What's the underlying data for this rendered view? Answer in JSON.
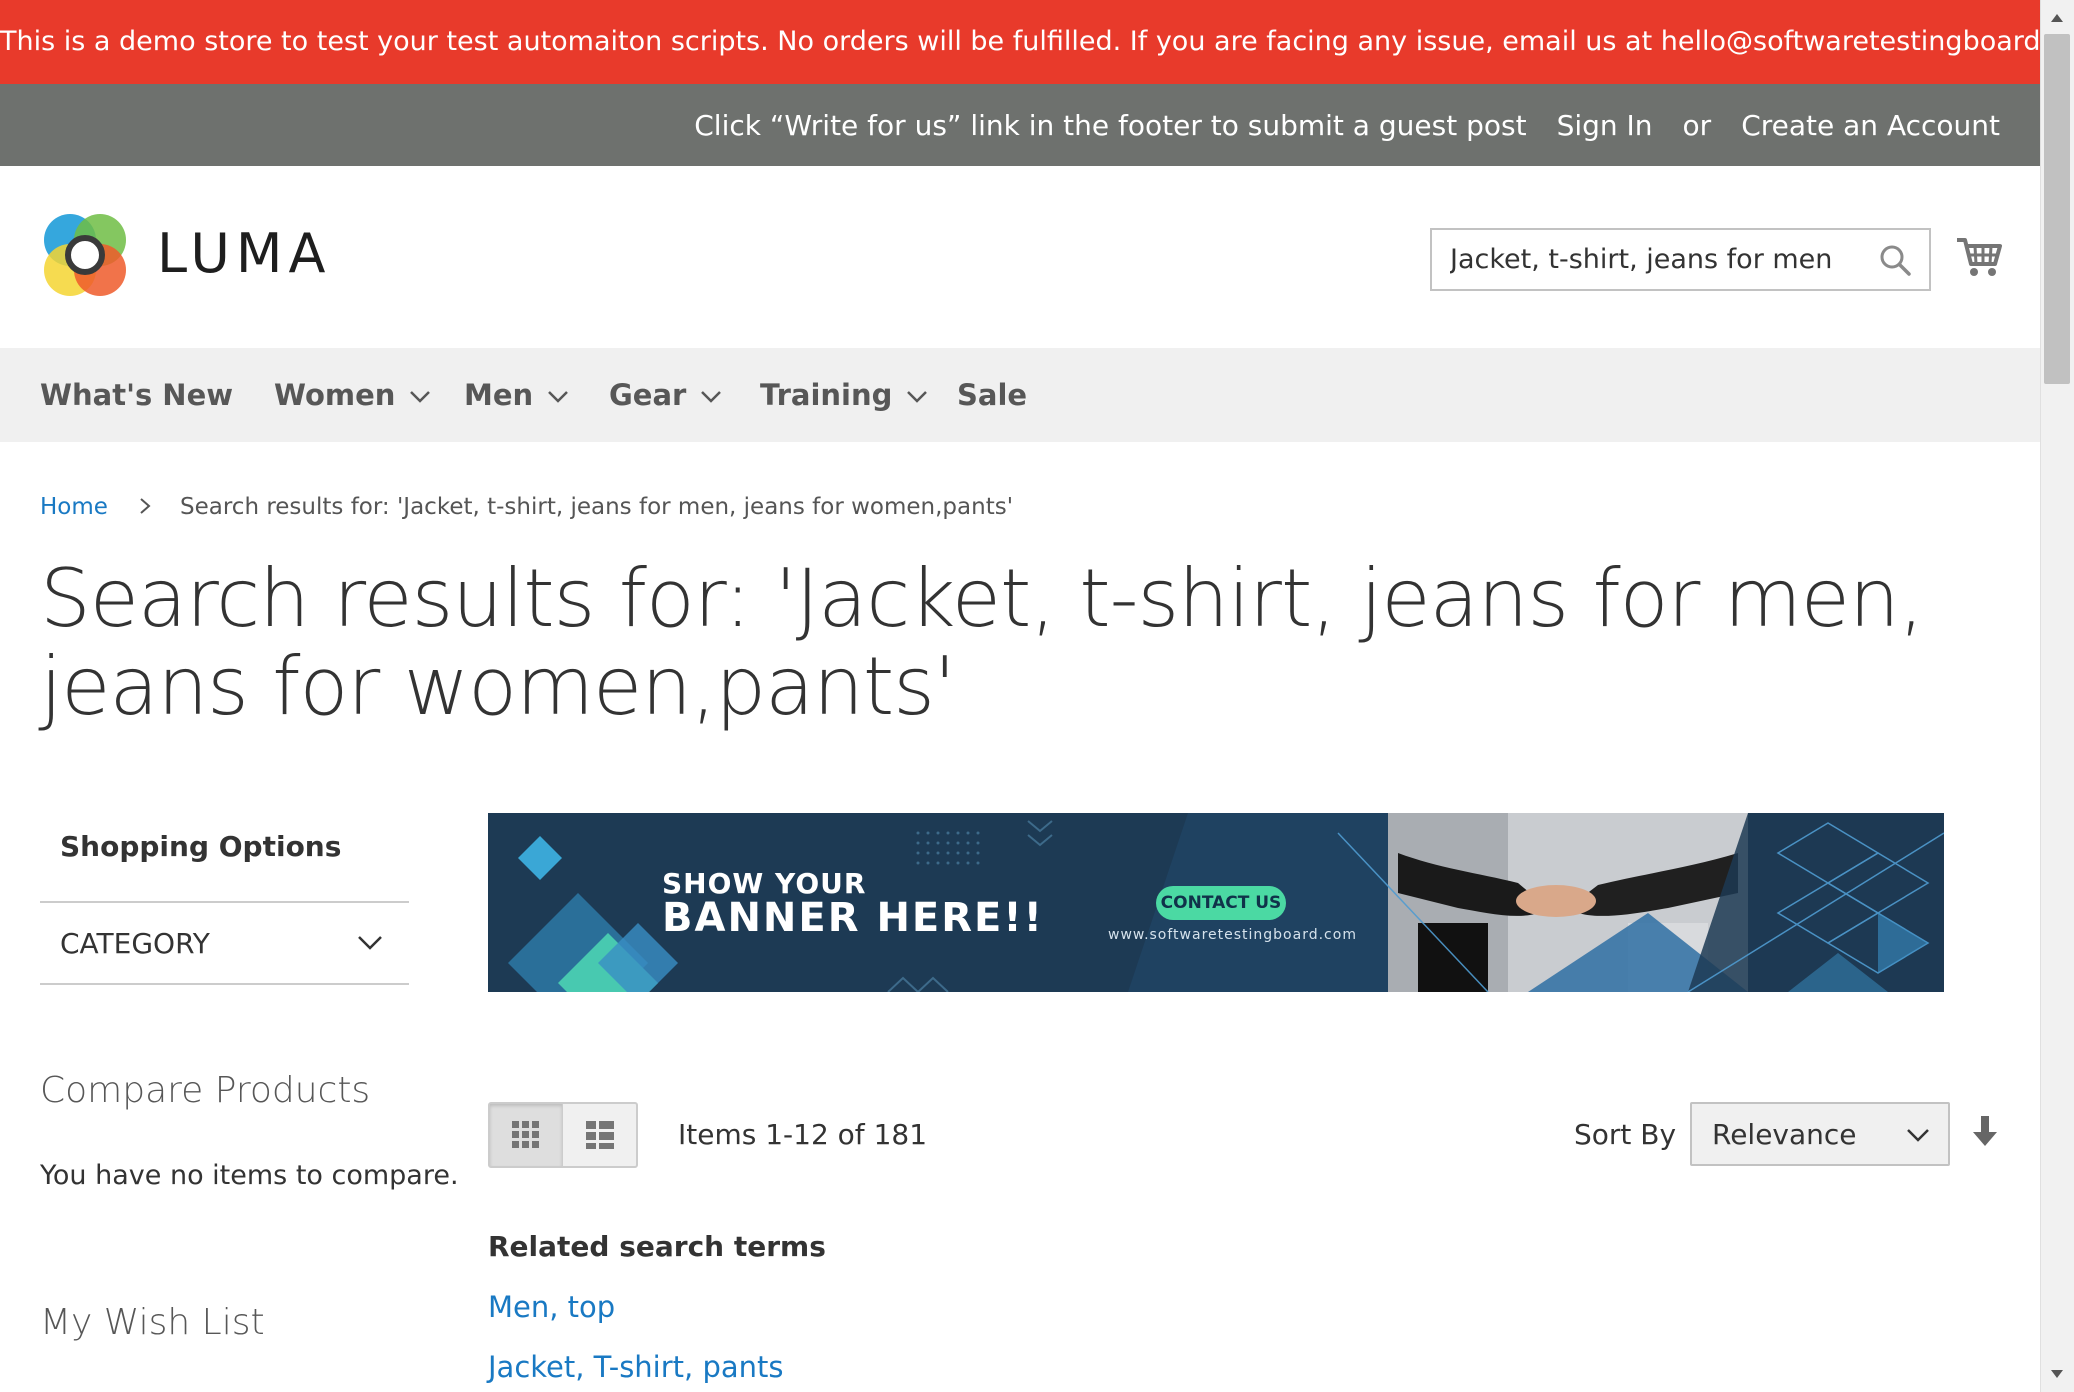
{
  "notice": {
    "text": "This is a demo store to test your test automaiton scripts. No orders will be fulfilled. If you are facing any issue, email us at hello@softwaretestingboard.com."
  },
  "panel": {
    "guest_post": "Click “Write for us” link in the footer to submit a guest post",
    "sign_in": "Sign In",
    "or": "or",
    "create_account": "Create an Account"
  },
  "header": {
    "logo_text": "LUMA",
    "search_value": "Jacket, t-shirt, jeans for men, jeans for women,pants"
  },
  "nav": {
    "items": [
      {
        "label": "What's New"
      },
      {
        "label": "Women"
      },
      {
        "label": "Men"
      },
      {
        "label": "Gear"
      },
      {
        "label": "Training"
      },
      {
        "label": "Sale"
      }
    ]
  },
  "breadcrumb": {
    "home": "Home",
    "current": "Search results for: 'Jacket, t-shirt, jeans for men, jeans for women,pants'"
  },
  "page_title": "Search results for: 'Jacket, t-shirt, jeans for men, jeans for women,pants'",
  "sidebar": {
    "shopping_options": "Shopping Options",
    "category_filter": "Category",
    "compare_title": "Compare Products",
    "compare_empty": "You have no items to compare.",
    "wishlist_title": "My Wish List"
  },
  "banner": {
    "line1": "SHOW YOUR",
    "line2": "BANNER HERE!!",
    "cta": "CONTACT US",
    "url": "www.softwaretestingboard.com"
  },
  "toolbar": {
    "items_count": "Items 1-12 of 181",
    "sort_label": "Sort By",
    "sort_value": "Relevance"
  },
  "related": {
    "title": "Related search terms",
    "terms": [
      "Men, top",
      "Jacket, T-shirt, pants"
    ]
  },
  "colors": {
    "notice_bg": "#e83a2b",
    "panel_bg": "#6e716e",
    "link": "#1979c3",
    "banner_bg": "#1d3a54",
    "banner_accent": "#4bd9a3"
  }
}
